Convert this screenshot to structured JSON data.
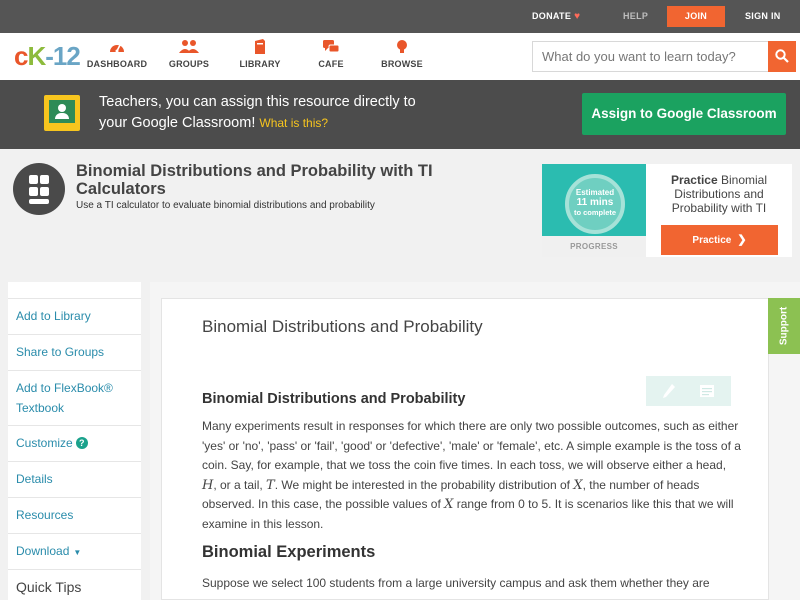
{
  "topbar": {
    "donate_label": "DONATE",
    "heart": "♥",
    "help_label": "HELP",
    "join_label": "JOIN",
    "signin_label": "SIGN IN",
    "accent_color": "#f16531"
  },
  "nav": {
    "logo": {
      "part1": "c",
      "part2": "K",
      "part3": "-12"
    },
    "items": [
      {
        "label": "DASHBOARD",
        "icon": "dashboard-gauge-icon"
      },
      {
        "label": "GROUPS",
        "icon": "groups-people-icon"
      },
      {
        "label": "LIBRARY",
        "icon": "library-book-icon"
      },
      {
        "label": "CAFE",
        "icon": "cafe-chat-icon"
      },
      {
        "label": "BROWSE",
        "icon": "browse-lightbulb-icon"
      }
    ],
    "search_placeholder": "What do you want to learn today?",
    "search_icon": "search-icon"
  },
  "classroom_banner": {
    "text_line1": "Teachers, you can assign this resource directly to",
    "text_line2": "your Google Classroom!",
    "what_link": "What is this?",
    "assign_button": "Assign to Google Classroom",
    "banner_color": "#4c4c4c",
    "button_color": "#1ba260"
  },
  "header": {
    "title": "Binomial Distributions and Probability with TI Calculators",
    "description": "Use a TI calculator to evaluate binomial distributions and probability"
  },
  "practice": {
    "estimated_label": "Estimated",
    "minutes": "11 mins",
    "complete_label": "to complete",
    "progress_label": "PROGRESS",
    "title_bold": "Practice",
    "title_rest": "Binomial Distributions and Probability with TI",
    "button_label": "Practice",
    "button_arrow": "❯"
  },
  "sidebar": {
    "items": [
      {
        "label": "Add to Library"
      },
      {
        "label": "Share to Groups"
      },
      {
        "label": "Add to FlexBook®"
      },
      {
        "label": "Textbook"
      },
      {
        "label": "Customize",
        "badge": "?"
      },
      {
        "label": "Details"
      },
      {
        "label": "Resources"
      },
      {
        "label": "Download",
        "caret": "▼"
      }
    ],
    "quick_tips": "Quick Tips"
  },
  "content": {
    "title": "Binomial Distributions and Probability",
    "section1_heading": "Binomial Distributions and Probability",
    "section1_text_1": "Many experiments result in responses for which there are only two possible outcomes, such as either 'yes' or 'no', 'pass' or 'fail', 'good' or 'defective', 'male' or 'female', etc. A simple example is the toss of a coin. Say, for example, that we toss the coin five times. In each toss, we will observe either a head, ",
    "var_h": "H",
    "section1_text_2": ", or a tail, ",
    "var_t": "T",
    "section1_text_3": ". We might be interested in the probability distribution of ",
    "var_x1": "X",
    "section1_text_4": ", the number of heads observed. In this case, the possible values of ",
    "var_x2": "X",
    "section1_text_5": " range from 0 to 5. It is scenarios like this that we will examine in this lesson.",
    "section2_heading": "Binomial Experiments",
    "section2_text": "Suppose we select 100 students from a large university campus and ask them whether they are"
  },
  "support_tab": {
    "label": "Support",
    "color": "#8cc152"
  }
}
